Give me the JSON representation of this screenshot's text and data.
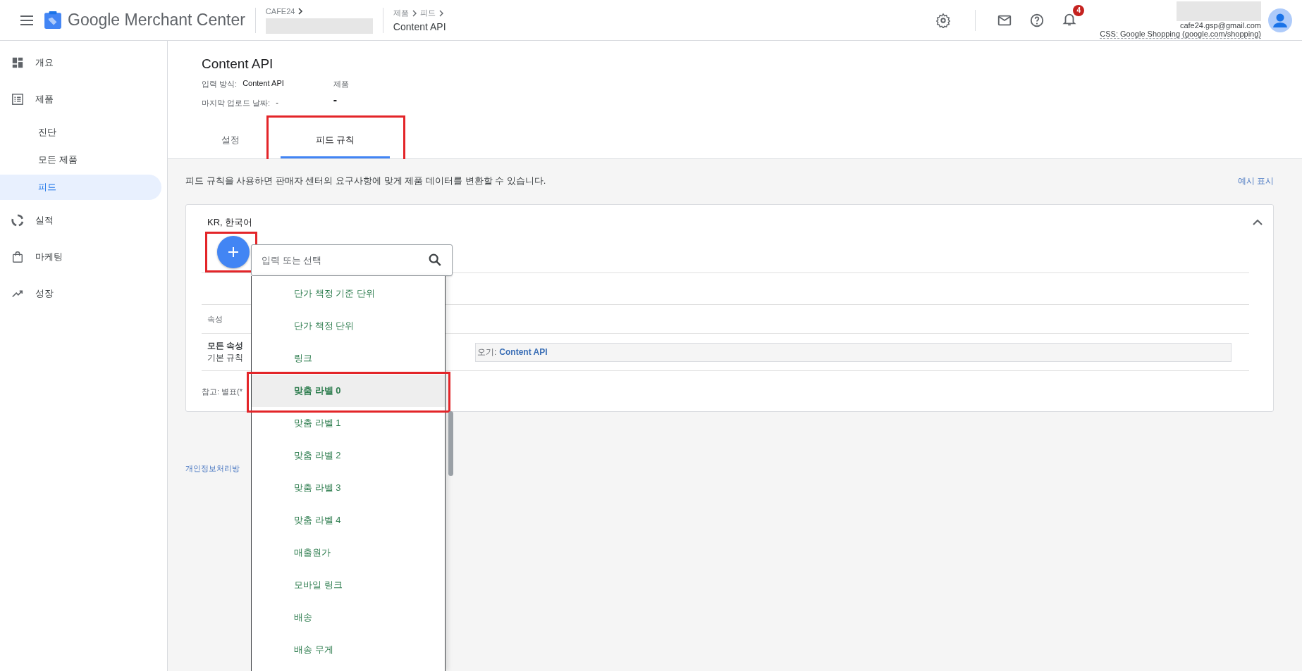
{
  "app_bar": {
    "title": "Google Merchant Center",
    "account_label": "CAFE24",
    "breadcrumb": [
      "제품",
      "피드"
    ],
    "page": "Content API",
    "notification_count": "4",
    "email": "cafe24.gsp@gmail.com",
    "css_label": "CSS: Google Shopping (google.com/shopping)"
  },
  "sidebar": {
    "items": [
      {
        "label": "개요",
        "kind": "overview",
        "selected": false
      },
      {
        "label": "제품",
        "kind": "products",
        "selected": false,
        "children": [
          {
            "label": "진단",
            "selected": false
          },
          {
            "label": "모든 제품",
            "selected": false
          },
          {
            "label": "피드",
            "selected": true
          }
        ]
      },
      {
        "label": "실적",
        "kind": "performance",
        "selected": false
      },
      {
        "label": "마케팅",
        "kind": "marketing",
        "selected": false
      },
      {
        "label": "성장",
        "kind": "growth",
        "selected": false
      }
    ]
  },
  "header": {
    "title": "Content API",
    "fields": [
      {
        "label": "입력 방식:",
        "value": "Content API"
      },
      {
        "label": "마지막 업로드 날짜:",
        "value": "-"
      }
    ],
    "stat": {
      "label": "제품",
      "value": "-"
    }
  },
  "tabs": [
    {
      "label": "설정",
      "selected": false,
      "annotated": false
    },
    {
      "label": "피드 규칙",
      "selected": true,
      "annotated": true
    }
  ],
  "description": "피드 규칙을 사용하면 판매자 센터의 요구사항에 맞게 제품 데이터를 변환할 수 있습니다.",
  "example_link": "예시 표시",
  "card": {
    "title": "KR, 한국어",
    "expanded": true,
    "add_button": {
      "annotated": true
    },
    "search": {
      "placeholder": "입력 또는 선택"
    },
    "table": {
      "header": "속성",
      "rows": [
        {
          "attribute": "모든 속성",
          "rule": "기본 규칙",
          "source_prefix": "오기:",
          "source": "Content API"
        }
      ]
    },
    "note": "참고: 별표(*"
  },
  "dropdown": {
    "items": [
      {
        "label": "단가 책정 기준 단위",
        "selected": false,
        "annotated": false
      },
      {
        "label": "단가 책정 단위",
        "selected": false,
        "annotated": false
      },
      {
        "label": "링크",
        "selected": false,
        "annotated": false
      },
      {
        "label": "맞춤 라벨 0",
        "selected": true,
        "annotated": true
      },
      {
        "label": "맞춤 라벨 1",
        "selected": false,
        "annotated": false
      },
      {
        "label": "맞춤 라벨 2",
        "selected": false,
        "annotated": false
      },
      {
        "label": "맞춤 라벨 3",
        "selected": false,
        "annotated": false
      },
      {
        "label": "맞춤 라벨 4",
        "selected": false,
        "annotated": false
      },
      {
        "label": "매출원가",
        "selected": false,
        "annotated": false
      },
      {
        "label": "모바일 링크",
        "selected": false,
        "annotated": false
      },
      {
        "label": "배송",
        "selected": false,
        "annotated": false
      },
      {
        "label": "배송 무게",
        "selected": false,
        "annotated": false
      }
    ]
  },
  "footer_link": "개인정보처리방"
}
